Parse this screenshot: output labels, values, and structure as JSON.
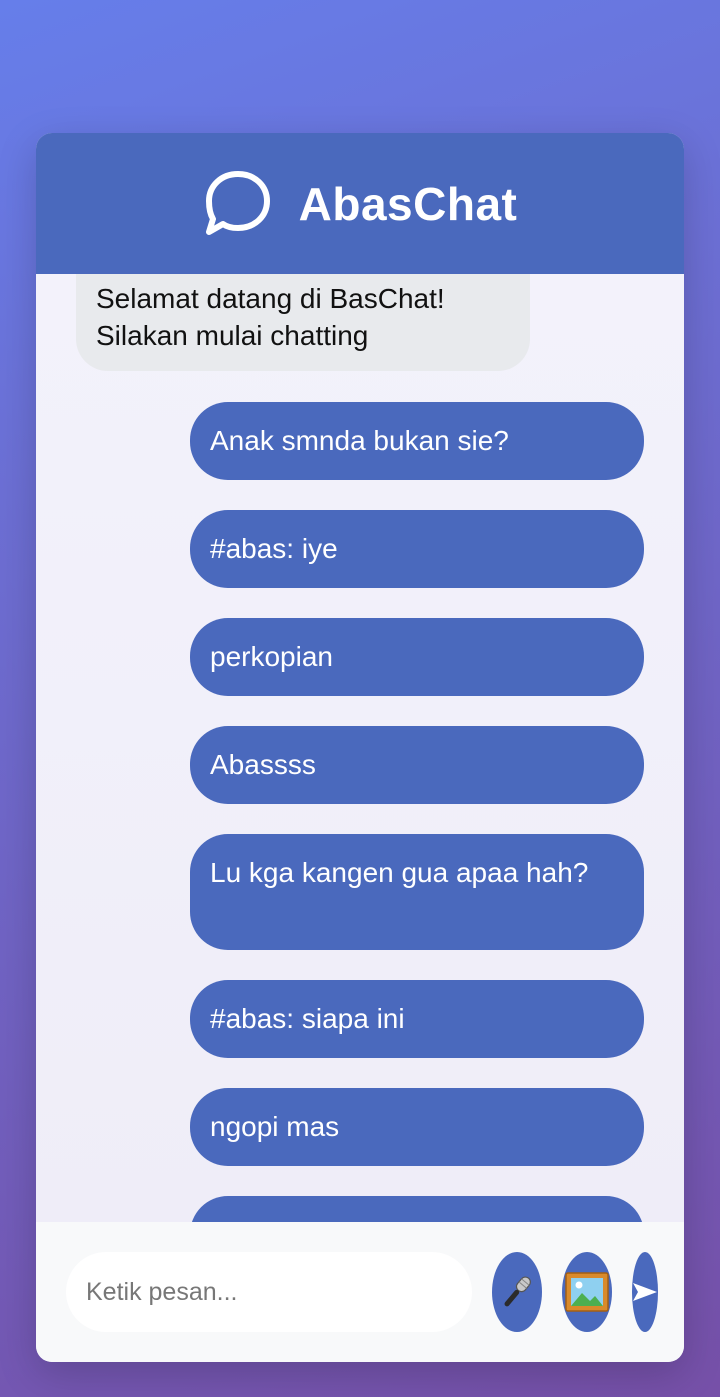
{
  "app": {
    "title": "AbasChat"
  },
  "messages": [
    {
      "direction": "incoming",
      "text": "Selamat datang di BasChat! Silakan mulai chatting"
    },
    {
      "direction": "outgoing",
      "text": "Anak smnda bukan sie?"
    },
    {
      "direction": "outgoing",
      "text": "#abas: iye"
    },
    {
      "direction": "outgoing",
      "text": "perkopian"
    },
    {
      "direction": "outgoing",
      "text": "Abassss"
    },
    {
      "direction": "outgoing",
      "text": "Lu kga kangen gua apaa hah?"
    },
    {
      "direction": "outgoing",
      "text": "#abas: siapa ini"
    },
    {
      "direction": "outgoing",
      "text": "ngopi mas"
    },
    {
      "direction": "outgoing",
      "text": ""
    }
  ],
  "composer": {
    "placeholder": "Ketik pesan...",
    "value": "",
    "mic_icon": "microphone-icon",
    "image_icon": "framed-picture-icon",
    "send_icon": "send-arrow-icon"
  },
  "colors": {
    "accent": "#4a69bd",
    "incoming_bubble": "#e8eaed",
    "background_gradient_start": "#667eea",
    "background_gradient_end": "#764ba2"
  }
}
